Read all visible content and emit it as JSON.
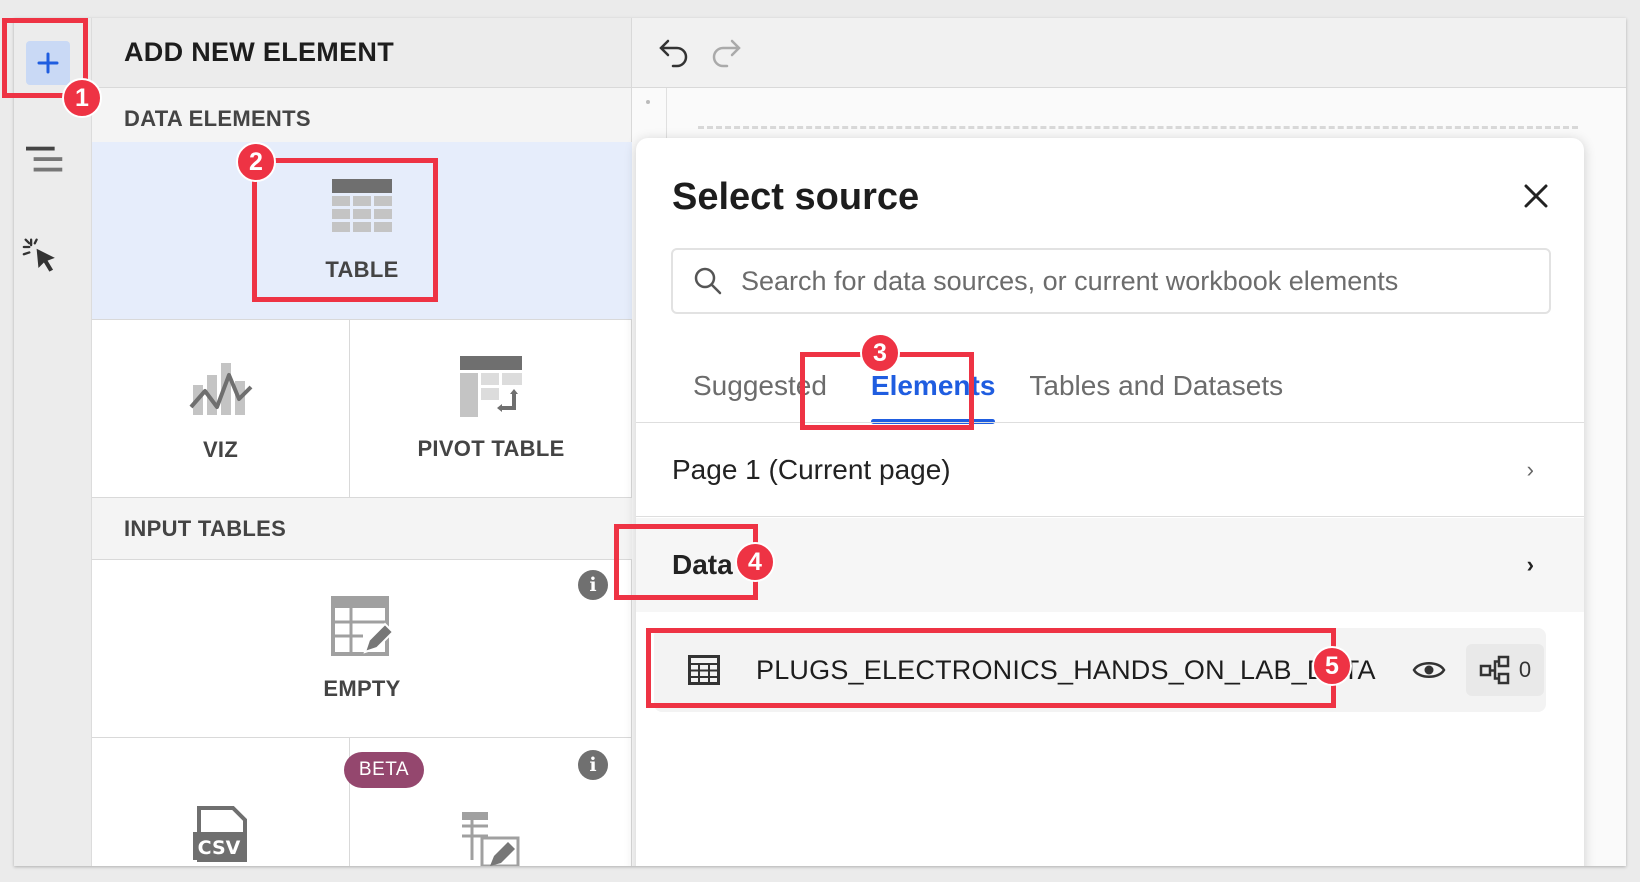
{
  "panel": {
    "title": "ADD NEW ELEMENT",
    "data_section": "DATA ELEMENTS",
    "input_section": "INPUT TABLES",
    "tiles": {
      "table": "TABLE",
      "viz": "VIZ",
      "pivot": "PIVOT TABLE",
      "empty": "EMPTY",
      "csv_badge": "BETA",
      "csv_icon": "CSV"
    }
  },
  "dialog": {
    "title": "Select source",
    "search_placeholder": "Search for data sources, or current workbook elements",
    "tabs": [
      "Suggested",
      "Elements",
      "Tables and Datasets"
    ],
    "active_tab": "Elements",
    "rows": {
      "page": "Page 1 (Current page)",
      "data": "Data"
    },
    "source": {
      "name": "PLUGS_ELECTRONICS_HANDS_ON_LAB_DATA",
      "lineage_count": "0"
    }
  },
  "callouts": [
    "1",
    "2",
    "3",
    "4",
    "5"
  ],
  "icons": [
    "plus-icon",
    "outline-icon",
    "pointer-icon",
    "undo-icon",
    "redo-icon",
    "table-icon",
    "viz-icon",
    "pivot-icon",
    "empty-table-icon",
    "csv-icon",
    "search-icon",
    "close-icon",
    "chevron-right-icon",
    "grid-icon",
    "eye-icon",
    "lineage-icon",
    "info-icon"
  ],
  "colors": {
    "accent": "#1f5de0",
    "callout": "#ee3344",
    "beta": "#94476e",
    "selected_tile": "#e6edfb"
  }
}
